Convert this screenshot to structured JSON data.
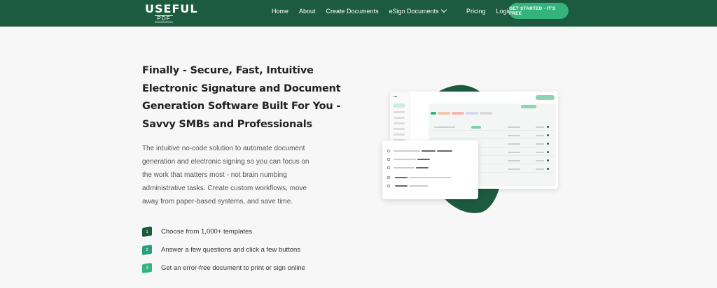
{
  "header": {
    "logo": {
      "word": "USEFUL",
      "sub": "PDF"
    },
    "nav": [
      {
        "label": "Home"
      },
      {
        "label": "About"
      },
      {
        "label": "Create Documents"
      },
      {
        "label": "eSign Documents",
        "icon": "chevron-down-icon"
      }
    ],
    "right_nav": [
      {
        "label": "Pricing"
      },
      {
        "label": "Login"
      }
    ],
    "cta": "GET STARTED - IT'S FREE"
  },
  "hero": {
    "headline": "Finally - Secure, Fast, Intuitive Electronic Signature and Document Generation Software Built For You - Savvy SMBs and Professionals",
    "description": "The intuitive no-code solution to automate document generation and electronic signing so you can focus on the work that matters most - not brain numbing administrative tasks. Create custom workflows, move away from paper-based systems, and save time."
  },
  "features": [
    {
      "num": "1",
      "text": "Choose from 1,000+ templates"
    },
    {
      "num": "2",
      "text": "Answer a few questions and click a few buttons"
    },
    {
      "num": "3",
      "text": "Get an error-free document to print or sign online"
    }
  ],
  "colors": {
    "brand": "#1d5b3f",
    "accent": "#34b37c",
    "background": "#f7f7f7"
  }
}
